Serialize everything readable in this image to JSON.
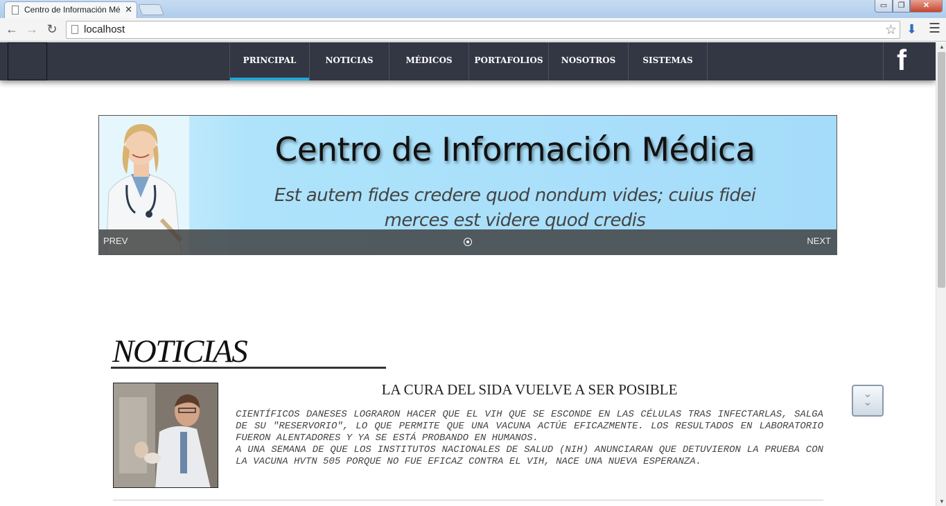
{
  "browser": {
    "tab_title": "Centro de Información Mé",
    "tab_close": "✕",
    "url": "localhost",
    "window_controls": {
      "minimize": "▭",
      "maximize": "❐",
      "close": "✕"
    }
  },
  "nav": {
    "items": [
      {
        "label": "PRINCIPAL",
        "active": true
      },
      {
        "label": "NOTICIAS",
        "active": false
      },
      {
        "label": "MÉDICOS",
        "active": false
      },
      {
        "label": "PORTAFOLIOS",
        "active": false
      },
      {
        "label": "NOSOTROS",
        "active": false
      },
      {
        "label": "SISTEMAS",
        "active": false
      }
    ],
    "social": "f",
    "accent_color": "#23a7d9",
    "bar_color": "#333744"
  },
  "slider": {
    "title": "Centro de Información Médica",
    "subtitle_line1": "Est autem fides credere quod nondum vides; cuius fidei",
    "subtitle_line2": "merces est videre quod credis",
    "prev": "PREV",
    "next": "NEXT"
  },
  "news": {
    "section_title": "NOTICIAS",
    "headline": "LA CURA DEL SIDA VUELVE A SER POSIBLE",
    "paragraph1": "CIENTÍFICOS DANESES LOGRARON HACER QUE EL VIH QUE SE ESCONDE EN LAS CÉLULAS TRAS INFECTARLAS, SALGA DE SU \"RESERVORIO\", LO QUE PERMITE QUE UNA VACUNA ACTÚE EFICAZMENTE. LOS RESULTADOS EN LABORATORIO FUERON ALENTADORES Y YA SE ESTÁ PROBANDO EN HUMANOS.",
    "paragraph2": "A UNA SEMANA DE QUE LOS INSTITUTOS NACIONALES DE SALUD (NIH) ANUNCIARAN QUE DETUVIERON LA PRUEBA CON LA VACUNA HVTN 505 PORQUE NO FUE EFICAZ CONTRA EL VIH, NACE UNA NUEVA ESPERANZA."
  }
}
